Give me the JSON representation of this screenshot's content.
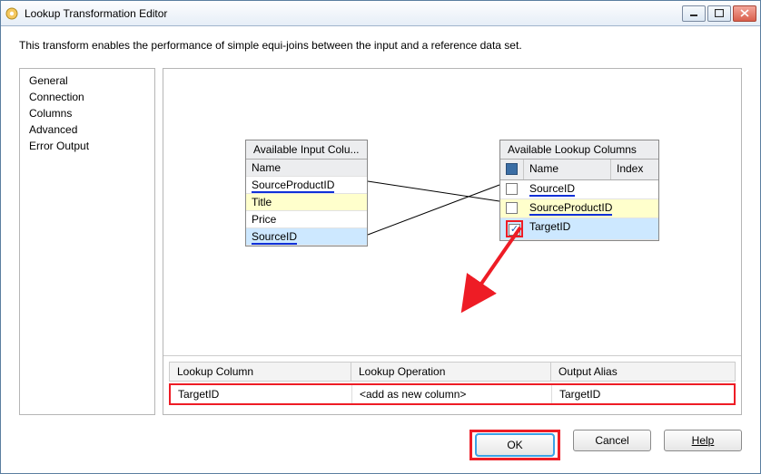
{
  "window": {
    "title": "Lookup Transformation Editor"
  },
  "description": "This transform enables the performance of simple equi-joins between the input and a reference data set.",
  "sidebar": {
    "items": [
      {
        "label": "General"
      },
      {
        "label": "Connection"
      },
      {
        "label": "Columns"
      },
      {
        "label": "Advanced"
      },
      {
        "label": "Error Output"
      }
    ]
  },
  "inputBox": {
    "title": "Available Input Colu...",
    "header": "Name",
    "rows": [
      {
        "label": "SourceProductID"
      },
      {
        "label": "Title"
      },
      {
        "label": "Price"
      },
      {
        "label": "SourceID"
      }
    ]
  },
  "lookupBox": {
    "title": "Available Lookup Columns",
    "headers": {
      "name": "Name",
      "index": "Index"
    },
    "rows": [
      {
        "label": "SourceID",
        "checked": false
      },
      {
        "label": "SourceProductID",
        "checked": false
      },
      {
        "label": "TargetID",
        "checked": true
      }
    ]
  },
  "mapping": {
    "headers": {
      "lookup": "Lookup Column",
      "op": "Lookup Operation",
      "alias": "Output Alias"
    },
    "row": {
      "lookup": "TargetID",
      "op": "<add as new column>",
      "alias": "TargetID"
    }
  },
  "buttons": {
    "ok": "OK",
    "cancel": "Cancel",
    "help": "Help"
  }
}
